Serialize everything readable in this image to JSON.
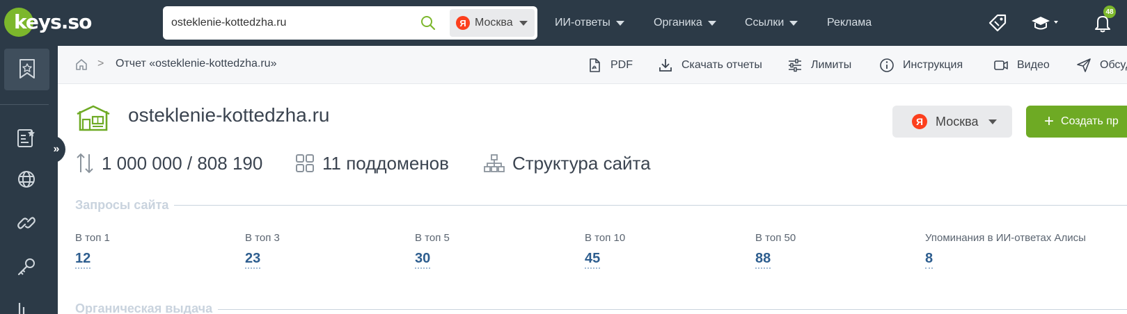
{
  "topbar": {
    "logo_text": "keys.so",
    "search": {
      "value": "osteklenie-kottedzha.ru",
      "placeholder": ""
    },
    "region": {
      "badge": "Я",
      "label": "Москва"
    },
    "nav": [
      {
        "label": "ИИ-ответы",
        "dropdown": true
      },
      {
        "label": "Органика",
        "dropdown": true
      },
      {
        "label": "Ссылки",
        "dropdown": true
      },
      {
        "label": "Реклама",
        "dropdown": false
      }
    ],
    "notifications_count": "48",
    "accent_color": "#7cb72c"
  },
  "sidebar": {
    "icons": [
      "bookmark-star-icon",
      "list-star-icon",
      "globe-icon",
      "link-icon",
      "key-icon"
    ],
    "collapse_label": "»"
  },
  "subheader": {
    "breadcrumb": {
      "separator": ">",
      "current": "Отчет «osteklenie-kottedzha.ru»"
    },
    "actions": [
      {
        "label": "PDF",
        "icon": "pdf-icon"
      },
      {
        "label": "Скачать отчеты",
        "icon": "download-icon"
      },
      {
        "label": "Лимиты",
        "icon": "sliders-icon"
      },
      {
        "label": "Инструкция",
        "icon": "info-icon"
      },
      {
        "label": "Видео",
        "icon": "video-icon"
      },
      {
        "label": "Обсуд",
        "icon": "send-icon"
      }
    ]
  },
  "site": {
    "domain": "osteklenie-kottedzha.ru",
    "region_button": {
      "badge": "Я",
      "label": "Москва"
    },
    "create_button": {
      "plus": "+",
      "label": "Создать пр"
    },
    "stats": {
      "pages": "1 000 000 / 808 190",
      "subdomains": "11 поддоменов",
      "structure": "Структура сайта"
    }
  },
  "queries": {
    "title": "Запросы сайта",
    "metrics": [
      {
        "label": "В топ 1",
        "value": "12"
      },
      {
        "label": "В топ 3",
        "value": "23"
      },
      {
        "label": "В топ 5",
        "value": "30"
      },
      {
        "label": "В топ 10",
        "value": "45"
      },
      {
        "label": "В топ 50",
        "value": "88"
      },
      {
        "label": "Упоминания в ИИ-ответах Алисы",
        "value": "8"
      }
    ]
  },
  "organic": {
    "title": "Органическая выдача"
  }
}
